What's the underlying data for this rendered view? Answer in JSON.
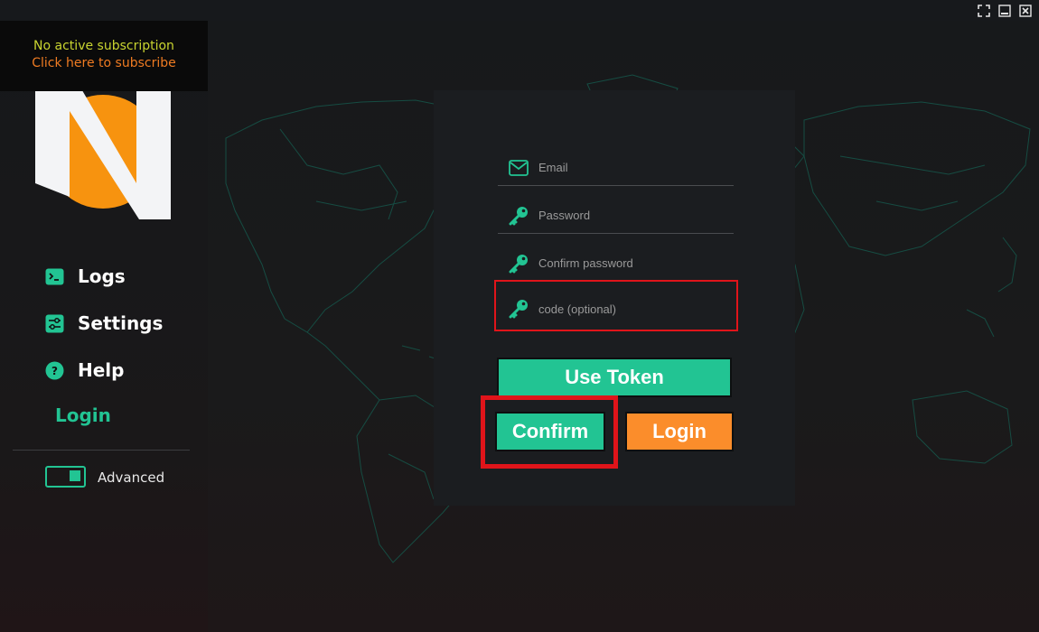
{
  "window": {
    "controls": [
      {
        "name": "fullscreen-button",
        "icon": "fullscreen-icon"
      },
      {
        "name": "minimize-button",
        "icon": "minimize-icon"
      },
      {
        "name": "close-button",
        "icon": "close-icon"
      }
    ]
  },
  "sidebar": {
    "subscription": {
      "status": "No active subscription",
      "cta": "Click here to subscribe"
    },
    "nav": {
      "logs": {
        "label": "Logs",
        "icon": "terminal-icon"
      },
      "settings": {
        "label": "Settings",
        "icon": "sliders-icon"
      },
      "help": {
        "label": "Help",
        "icon": "help-icon"
      },
      "login": {
        "label": "Login"
      }
    },
    "advanced": {
      "label": "Advanced",
      "enabled": true
    }
  },
  "form": {
    "email": {
      "placeholder": "Email",
      "value": "",
      "icon": "mail-icon"
    },
    "password": {
      "placeholder": "Password",
      "value": "",
      "icon": "key-icon"
    },
    "confirm_password": {
      "placeholder": "Confirm password",
      "value": "",
      "icon": "key-icon"
    },
    "code": {
      "placeholder": "code (optional)",
      "value": "",
      "icon": "key-icon"
    },
    "buttons": {
      "use_token": "Use Token",
      "confirm": "Confirm",
      "login": "Login"
    }
  },
  "colors": {
    "accent_green": "#22c493",
    "accent_orange": "#fb8d2b",
    "subscription_yellow": "#c9d430",
    "subscription_orange": "#ef7b22",
    "highlight_red": "#e0141a"
  }
}
